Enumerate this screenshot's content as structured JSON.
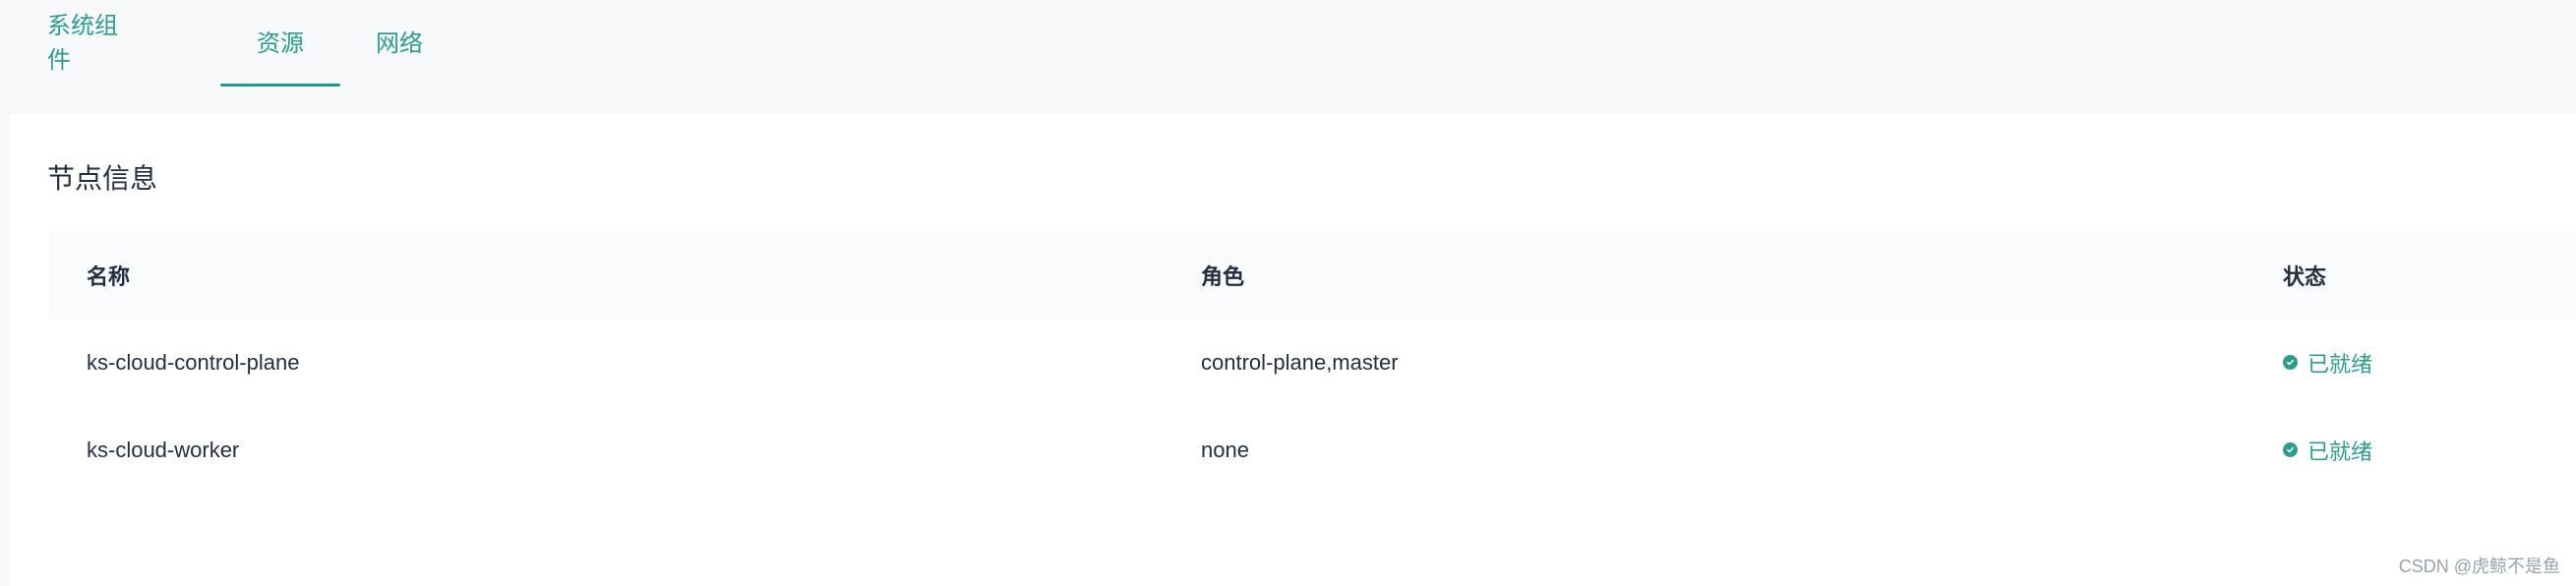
{
  "tabs": [
    {
      "label": "系统组件",
      "active": false
    },
    {
      "label": "资源",
      "active": true
    },
    {
      "label": "网络",
      "active": false
    }
  ],
  "section": {
    "title": "节点信息"
  },
  "table": {
    "headers": {
      "name": "名称",
      "role": "角色",
      "status": "状态"
    },
    "rows": [
      {
        "name": "ks-cloud-control-plane",
        "role": "control-plane,master",
        "status": "已就绪",
        "status_icon": "check-circle-icon"
      },
      {
        "name": "ks-cloud-worker",
        "role": "none",
        "status": "已就绪",
        "status_icon": "check-circle-icon"
      }
    ]
  },
  "watermark": "CSDN @虎鲸不是鱼",
  "colors": {
    "accent": "#2a9d8f",
    "text": "#242e42",
    "background": "#f7f9fb"
  }
}
